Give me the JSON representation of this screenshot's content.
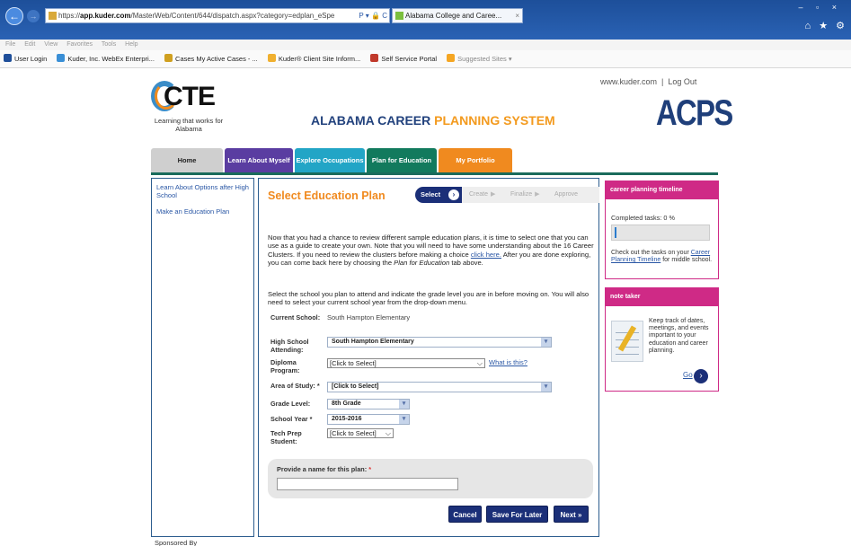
{
  "browser": {
    "url_prefix": "https://",
    "url_host": "app.kuder.com",
    "url_rest": "/MasterWeb/Content/644/dispatch.aspx?category=edplan_eSpe",
    "url_controls": "P ▾ 🔒 C",
    "tab_title": "Alabama College and Caree...",
    "tab_close": "×",
    "menu": [
      "File",
      "Edit",
      "View",
      "Favorites",
      "Tools",
      "Help"
    ],
    "favorites": [
      {
        "label": "User Login",
        "color": "#1f4f9a"
      },
      {
        "label": "Kuder, Inc. WebEx Enterpri...",
        "color": "#3a8fd6"
      },
      {
        "label": "Cases My Active Cases - ...",
        "color": "#d0a020"
      },
      {
        "label": "Kuder® Client Site Inform...",
        "color": "#f0b030"
      },
      {
        "label": "Self Service Portal",
        "color": "#c0392b"
      },
      {
        "label": "Suggested Sites ▾",
        "color": "#f5a623"
      }
    ],
    "window_controls": "–  ▫  ×",
    "toolbar_icons": "⌂ ★ ⚙"
  },
  "header": {
    "kuder_link": "www.kuder.com",
    "sep": "|",
    "logout": "Log Out",
    "cte_logo": "CTE",
    "cte_tagline": "Learning that works for Alabama",
    "title_a": "ALABAMA CAREER ",
    "title_b": "PLANNING SYSTEM",
    "acps_logo": "ACPS"
  },
  "nav": {
    "home": "Home",
    "learn": "Learn About Myself",
    "explore": "Explore Occupations",
    "plan": "Plan for Education",
    "portfolio": "My Portfolio"
  },
  "sidebar": {
    "items": [
      "Learn About Options after High School",
      "Make an Education Plan"
    ],
    "sponsored": "Sponsored By"
  },
  "main": {
    "title": "Select Education Plan",
    "steps": {
      "select": "Select",
      "create": "Create",
      "finalize": "Finalize",
      "approve": "Approve"
    },
    "intro_1": "Now that you had a chance to review different sample education plans, it is time to select one that you can use as a guide to create your own. Note that you will need to have some understanding about the 16 Career Clusters. If you need to review the clusters before making a choice ",
    "intro_link": "click here.",
    "intro_2": " After you are done exploring, you can come back here by choosing the ",
    "intro_italic": "Plan for Education",
    "intro_3": " tab above.",
    "intro_b": "Select the school you plan to attend and indicate the grade level you are in before moving on. You will also need to select your current school year from the drop-down menu.",
    "fields": {
      "current_school_label": "Current School:",
      "current_school_value": "South Hampton Elementary",
      "hs_label": "High School Attending:",
      "hs_value": "South Hampton Elementary",
      "diploma_label": "Diploma Program:",
      "diploma_value": "[Click to Select]",
      "what_is_this": "What is this?",
      "area_label": "Area of Study: *",
      "area_value": "[Click to Select]",
      "grade_label": "Grade Level:",
      "grade_value": "8th Grade",
      "year_label": "School Year *",
      "year_value": "2015-2016",
      "techprep_label": "Tech Prep Student:",
      "techprep_value": "[Click to Select]"
    },
    "name_label": "Provide a name for this plan: ",
    "name_req": "*",
    "buttons": {
      "cancel": "Cancel",
      "save": "Save For Later",
      "next": "Next »"
    }
  },
  "right": {
    "timeline_title": "career planning timeline",
    "completed": "Completed tasks: 0 %",
    "completed_fraction": 0,
    "timeline_text_1": "Check out the tasks on your ",
    "timeline_link": "Career Planning Timeline",
    "timeline_text_2": " for middle school.",
    "notetaker_title": "note taker",
    "notetaker_text": "Keep track of dates, meetings, and events important to your education and career planning.",
    "go": "Go"
  }
}
